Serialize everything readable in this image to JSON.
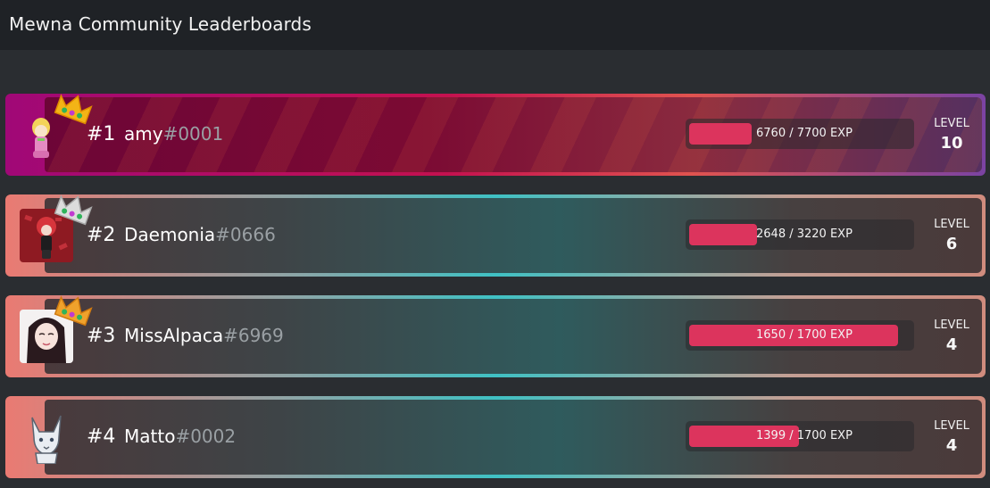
{
  "header": {
    "title": "Mewna Community Leaderboards"
  },
  "entries": [
    {
      "rank": "#1",
      "name": "amy",
      "discriminator": "#0001",
      "exp_text": "6760 / 7700 EXP",
      "exp_fraction": 0.29,
      "level_label": "LEVEL",
      "level": "10",
      "crown": "gold-crown-icon"
    },
    {
      "rank": "#2",
      "name": "Daemonia",
      "discriminator": "#0666",
      "exp_text": "2648 / 3220 EXP",
      "exp_fraction": 0.31,
      "level_label": "LEVEL",
      "level": "6",
      "crown": "silver-crown-icon"
    },
    {
      "rank": "#3",
      "name": "MissAlpaca",
      "discriminator": "#6969",
      "exp_text": "1650 / 1700 EXP",
      "exp_fraction": 0.93,
      "level_label": "LEVEL",
      "level": "4",
      "crown": "bronze-crown-icon"
    },
    {
      "rank": "#4",
      "name": "Matto",
      "discriminator": "#0002",
      "exp_text": "1399 / 1700 EXP",
      "exp_fraction": 0.49,
      "level_label": "LEVEL",
      "level": "4",
      "crown": ""
    }
  ],
  "colors": {
    "exp_fill": "#dc345d",
    "discriminator": "#9aa0a4"
  }
}
